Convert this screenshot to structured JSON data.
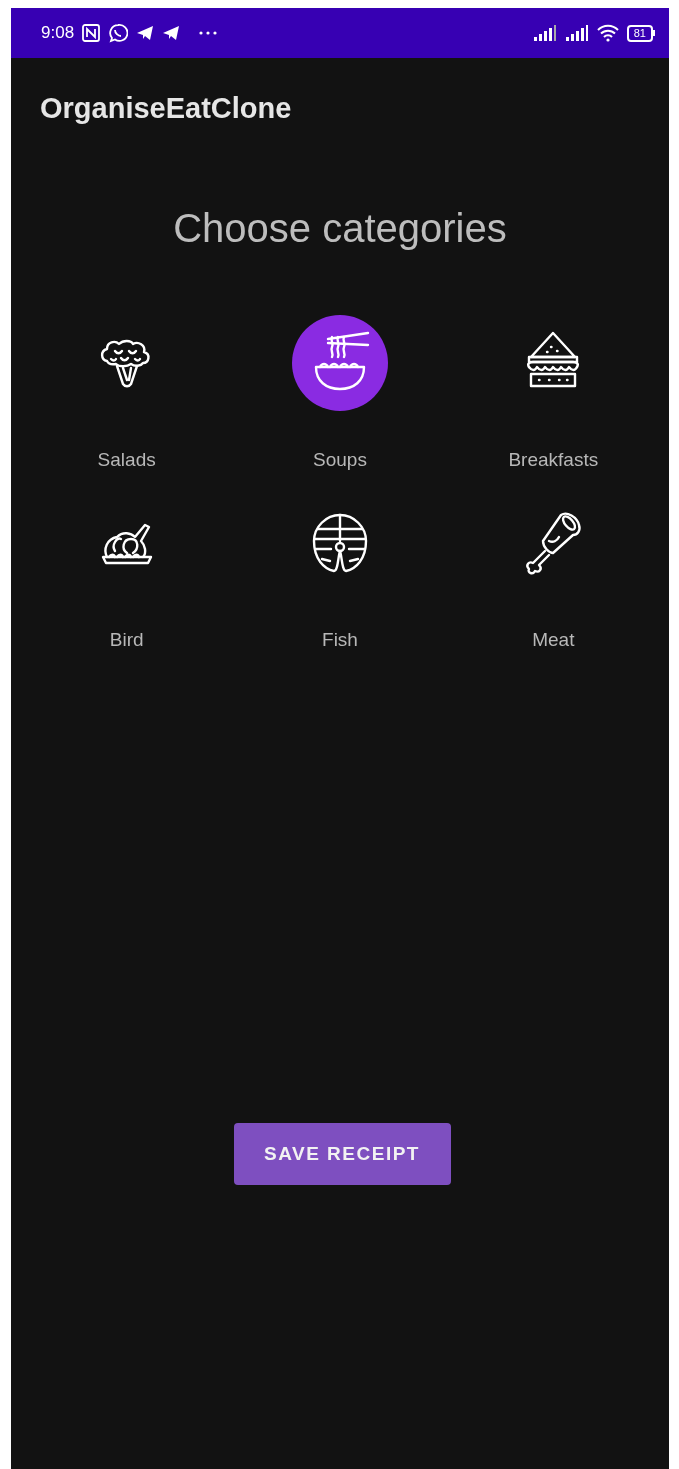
{
  "status_bar": {
    "time": "9:08",
    "battery": "81"
  },
  "app_bar": {
    "title": "OrganiseEatClone"
  },
  "heading": "Choose categories",
  "categories": [
    {
      "kind": "salads",
      "label": "Salads",
      "selected": false
    },
    {
      "kind": "soups",
      "label": "Soups",
      "selected": true
    },
    {
      "kind": "breakfasts",
      "label": "Breakfasts",
      "selected": false
    },
    {
      "kind": "bird",
      "label": "Bird",
      "selected": false
    },
    {
      "kind": "fish",
      "label": "Fish",
      "selected": false
    },
    {
      "kind": "meat",
      "label": "Meat",
      "selected": false
    }
  ],
  "save_button": "SAVE RECEIPT"
}
